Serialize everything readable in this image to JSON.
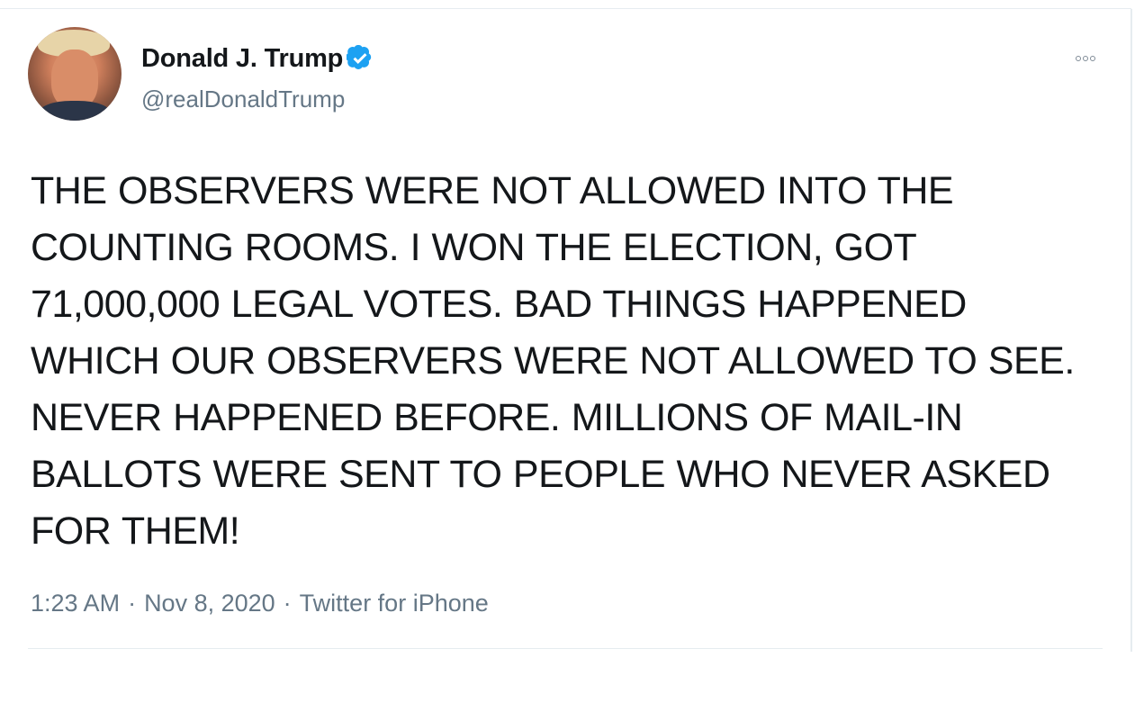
{
  "tweet": {
    "author": {
      "display_name": "Donald J. Trump",
      "handle": "@realDonaldTrump",
      "verified": true
    },
    "text": "THE OBSERVERS WERE NOT ALLOWED INTO THE\nCOUNTING ROOMS. I WON THE ELECTION, GOT\n71,000,000 LEGAL VOTES. BAD THINGS HAPPENED\nWHICH OUR OBSERVERS WERE NOT ALLOWED TO SEE.\nNEVER HAPPENED BEFORE. MILLIONS OF MAIL-IN\nBALLOTS WERE SENT TO PEOPLE WHO NEVER ASKED\nFOR THEM!",
    "time": "1:23 AM",
    "date": "Nov 8, 2020",
    "source": "Twitter for iPhone",
    "separator": "·"
  },
  "icons": {
    "verified": "verified-badge-icon",
    "more": "more-options-icon"
  },
  "colors": {
    "background": "#ffffff",
    "primary_text": "#14171a",
    "secondary_text": "#657786",
    "verified_blue": "#1da1f2",
    "border": "#e6ecf0"
  }
}
